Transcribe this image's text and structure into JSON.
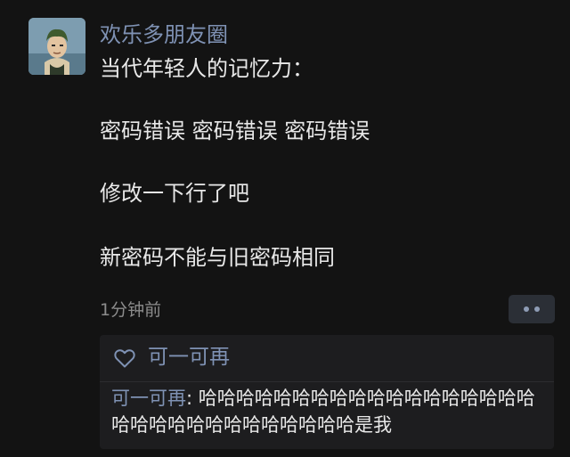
{
  "post": {
    "author": "欢乐多朋友圈",
    "lines": [
      "当代年轻人的记忆力：",
      "密码错误 密码错误 密码错误",
      "修改一下行了吧",
      "新密码不能与旧密码相同"
    ],
    "time": "1分钟前"
  },
  "likes": {
    "icon": "heart-outline-icon",
    "names": "可一可再"
  },
  "comment": {
    "author": "可一可再",
    "separator": ": ",
    "text": "哈哈哈哈哈哈哈哈哈哈哈哈哈哈哈哈哈哈哈哈哈哈哈哈哈哈哈哈哈哈哈是我"
  },
  "colors": {
    "background": "#131313",
    "link": "#7f92b4",
    "text": "#e8e8e8",
    "meta": "#8c8c8c"
  }
}
